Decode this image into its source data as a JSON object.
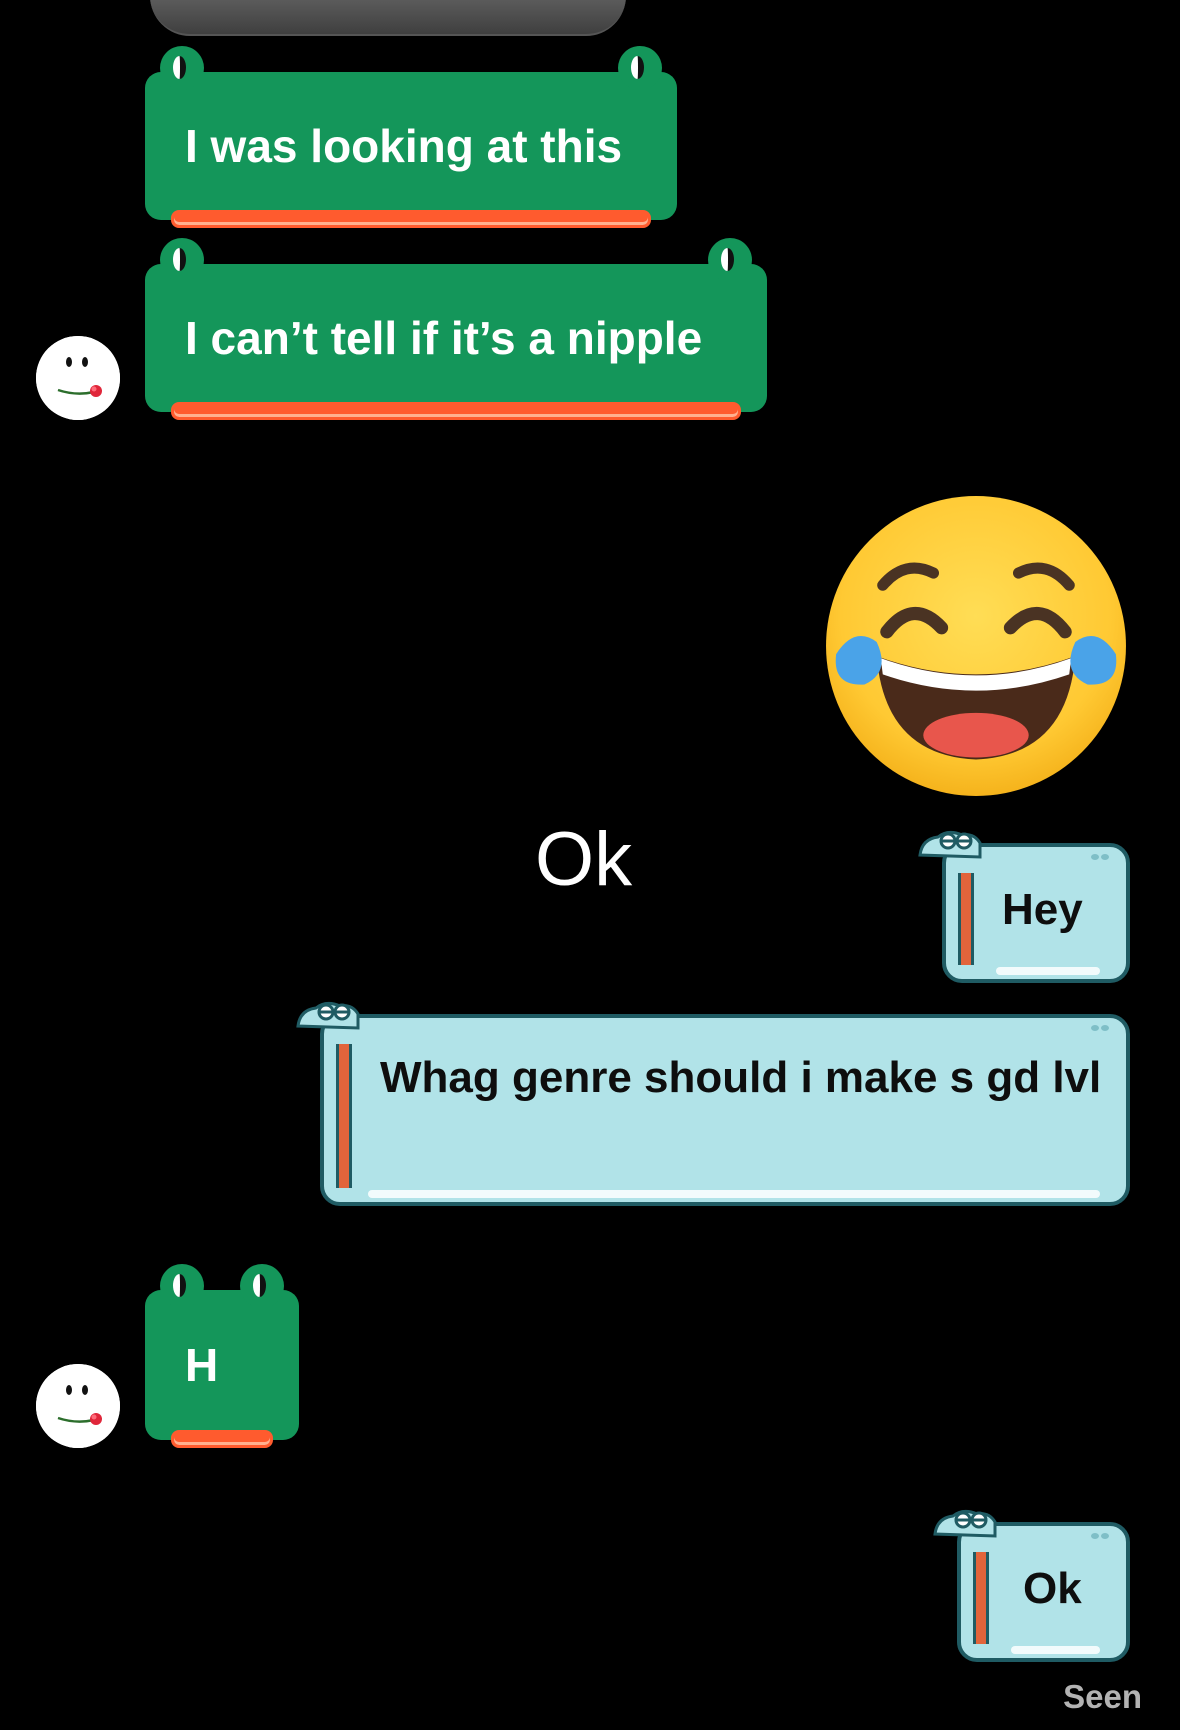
{
  "messages": {
    "incoming_1": "I was looking at this",
    "incoming_2": "I can’t tell if it’s a nipple",
    "plain_text": "Ok",
    "outgoing_1": "Hey",
    "outgoing_2": "Whag genre should i make s gd lvl",
    "incoming_3": "H",
    "outgoing_3": "Ok"
  },
  "status": {
    "seen": "Seen"
  },
  "icons": {
    "emoji": "face-with-tears-of-joy-icon",
    "avatar": "smiley-with-rose-icon"
  },
  "colors": {
    "background": "#000000",
    "incoming_bubble": "#14965a",
    "incoming_tongue": "#ff5b2e",
    "outgoing_bubble": "#b1e3e8",
    "outgoing_border": "#1f5b63",
    "seen_text": "#b3b3b3"
  }
}
